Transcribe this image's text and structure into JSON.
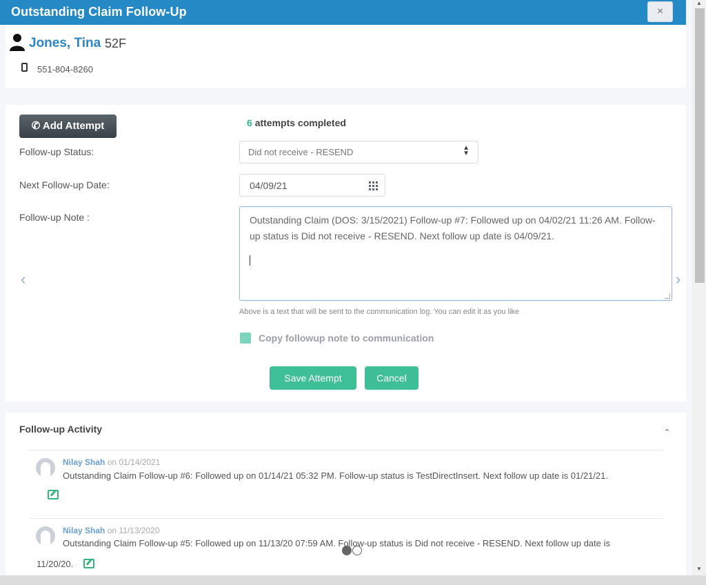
{
  "header": {
    "title": "Outstanding Claim Follow-Up",
    "close_label": "×"
  },
  "patient": {
    "name": "Jones, Tina",
    "age_sex": "52F",
    "phone": "551-804-8260",
    "icons": {
      "person": "person-icon",
      "phone": "mobile-phone-icon"
    }
  },
  "form": {
    "add_attempt_label": "Add Attempt",
    "attempts_count": "6",
    "attempts_text": "attempts completed",
    "status_label": "Follow-up Status:",
    "status_value": "Did not receive - RESEND",
    "next_date_label": "Next Follow-up Date:",
    "next_date_value": "04/09/21",
    "note_label": "Follow-up Note :",
    "note_value": "Outstanding Claim (DOS: 3/15/2021) Follow-up #7: Followed up on 04/02/21 11:26 AM. Follow-up status is Did not receive - RESEND. Next follow up date is 04/09/21.",
    "hint": "Above is a text that will be sent to the communication log. You can edit it as you like",
    "copy_label": "Copy followup note to communication",
    "save_label": "Save Attempt",
    "cancel_label": "Cancel",
    "prev_arrow": "‹",
    "next_arrow": "›"
  },
  "activity": {
    "title": "Follow-up Activity",
    "collapse_icon": "⌃",
    "entries": [
      {
        "author": "Nilay Shah",
        "date": "on 01/14/2021",
        "text": "Outstanding Claim Follow-up #6: Followed up on 01/14/21 05:32 PM. Follow-up status is TestDirectInsert. Next follow up date is 01/21/21.",
        "continuation": ""
      },
      {
        "author": "Nilay Shah",
        "date": "on 11/13/2020",
        "text": "Outstanding Claim Follow-up #5: Followed up on 11/13/20 07:59 AM. Follow-up status is Did not receive - RESEND. Next follow up date is",
        "continuation": "11/20/20."
      }
    ]
  },
  "colors": {
    "header": "#2489c5",
    "accent_green": "#3fbf95",
    "link_blue": "#2e86c1"
  }
}
